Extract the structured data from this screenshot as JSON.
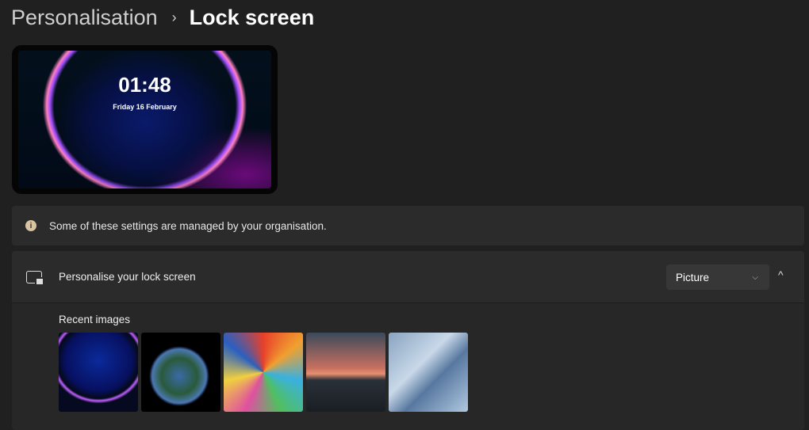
{
  "breadcrumb": {
    "parent": "Personalisation",
    "separator": "›",
    "current": "Lock screen"
  },
  "preview": {
    "time": "01:48",
    "date": "Friday 16 February"
  },
  "info": {
    "icon": "info-icon",
    "text": "Some of these settings are managed by your organisation."
  },
  "lock_screen": {
    "icon": "lock-screen-icon",
    "label": "Personalise your lock screen",
    "dropdown_value": "Picture",
    "dropdown_chevron": "⌵",
    "collapse_glyph": "^",
    "recent_label": "Recent images",
    "images": [
      "Windows bloom",
      "Earth",
      "Colourful lion mural",
      "Sunset over water",
      "Windows blue waves"
    ]
  }
}
